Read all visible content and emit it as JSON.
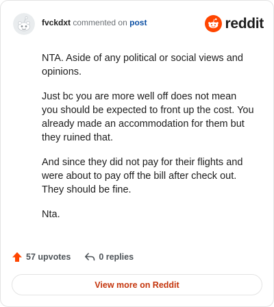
{
  "header": {
    "username": "fvckdxt",
    "action_text": "commented on",
    "post_link": "post",
    "brand_name": "reddit"
  },
  "comment": {
    "paragraphs": [
      "NTA. Aside of any political or social views and opinions.",
      "Just bc you are more well off does not mean you should be expected to front up the cost. You already made an accommodation for them but they ruined that.",
      "And since they did not pay for their flights and were about to pay off the bill after check out. They should be fine.",
      "Nta."
    ]
  },
  "actions": {
    "upvotes": "57 upvotes",
    "replies": "0 replies"
  },
  "footer": {
    "view_more_label": "View more on Reddit"
  },
  "colors": {
    "brand_orange": "#ff4500",
    "upvote_orange": "#ff4500",
    "link_blue": "#0b4fa3",
    "view_more_text": "#c4340b"
  },
  "icons": {
    "avatar": "reddit-snoo-avatar",
    "brand": "reddit-logo-icon",
    "upvote": "upvote-arrow-icon",
    "reply": "reply-arrow-icon"
  }
}
